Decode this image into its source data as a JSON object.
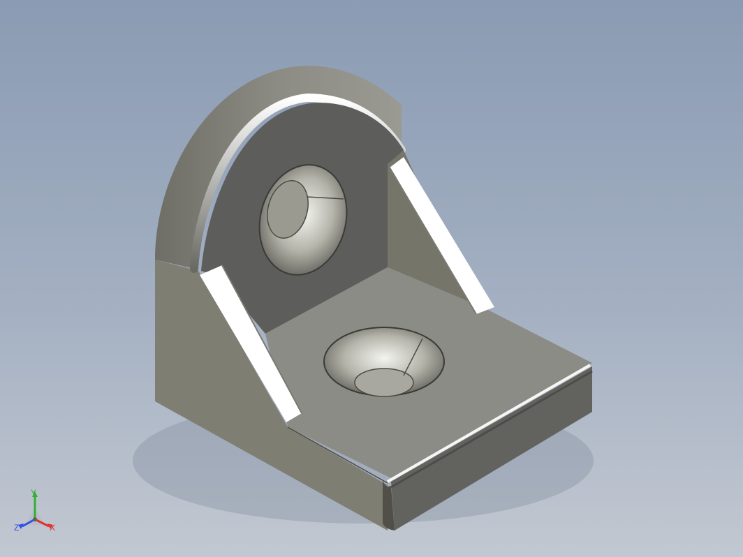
{
  "view": {
    "background_top": "#8a9bb3",
    "background_bottom": "#c2c8d1",
    "model_color": "#8a8a84",
    "model_shadow_color": "#5a5a5a"
  },
  "model": {
    "description_icon": "angle-bracket-model",
    "features": [
      "top-countersunk-hole",
      "front-countersunk-hole",
      "left-gusset",
      "right-gusset"
    ]
  },
  "triad": {
    "x_label": "X",
    "y_label": "Y",
    "z_label": "Z",
    "x_color": "#e03030",
    "y_color": "#30b030",
    "z_color": "#3050e0"
  }
}
